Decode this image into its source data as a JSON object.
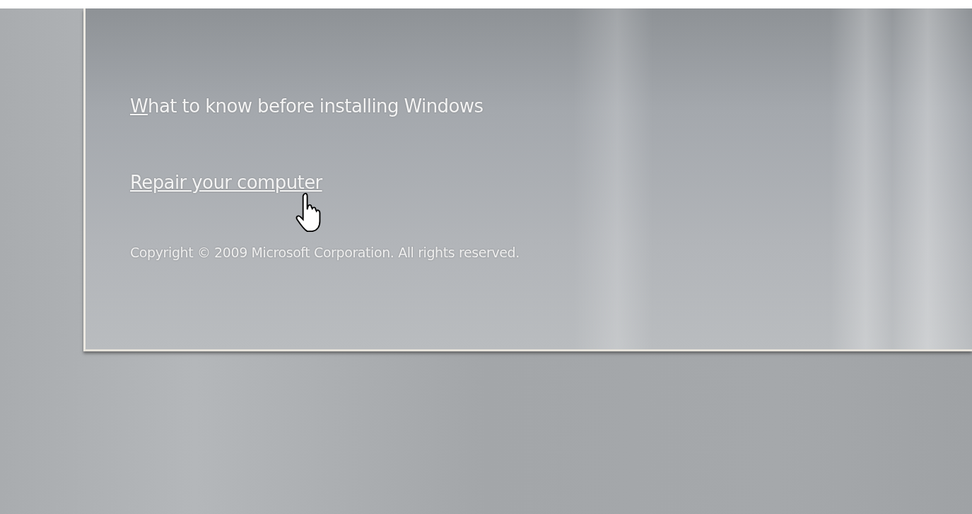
{
  "links": [
    {
      "label": "What to know before installing Windows",
      "underline_first": true,
      "hovered": false
    },
    {
      "label": "Repair your computer",
      "underline_first": false,
      "hovered": true
    }
  ],
  "copyright": "Copyright © 2009 Microsoft Corporation. All rights reserved."
}
